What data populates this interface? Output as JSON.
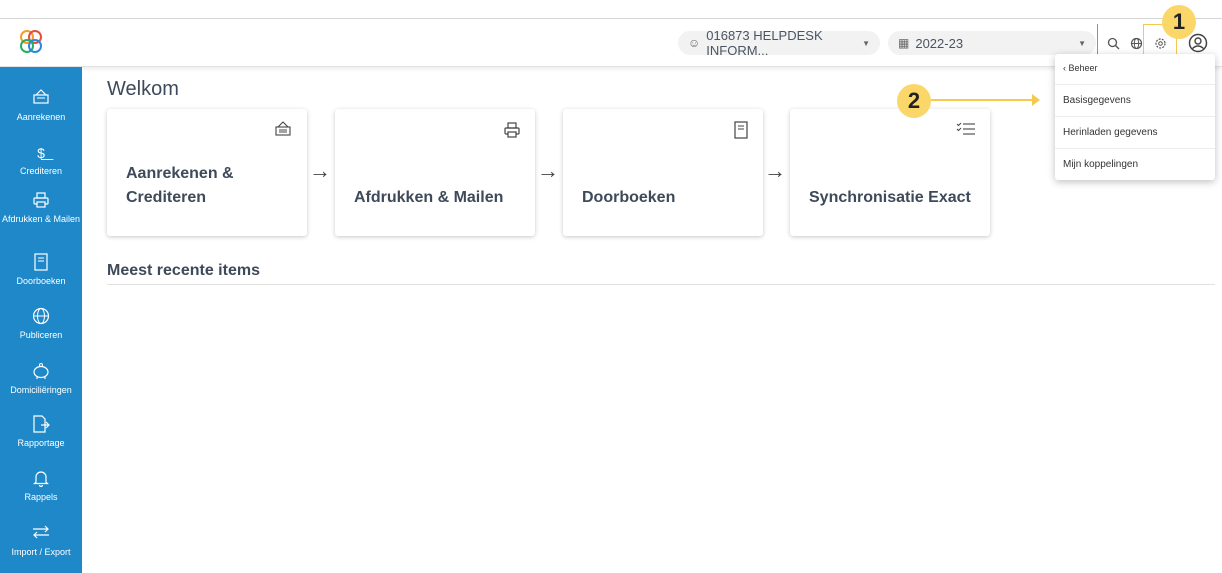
{
  "header": {
    "company_selector": {
      "value": "016873 HELPDESK INFORM...",
      "icon": "group-icon"
    },
    "year_selector": {
      "value": "2022-23",
      "icon": "calendar-icon"
    },
    "icons": [
      "search-icon",
      "globe-icon",
      "gear-icon",
      "user-icon"
    ]
  },
  "sidebar": {
    "items": [
      {
        "label": "Aanrekenen",
        "icon": "invoice-icon"
      },
      {
        "label": "Crediteren",
        "icon": "credit-icon"
      },
      {
        "label": "Afdrukken & Mailen",
        "icon": "printer-icon"
      },
      {
        "label": "Doorboeken",
        "icon": "ledger-icon"
      },
      {
        "label": "Publiceren",
        "icon": "globe-icon"
      },
      {
        "label": "Domiciliëringen",
        "icon": "piggybank-icon"
      },
      {
        "label": "Rapportage",
        "icon": "export-file-icon"
      },
      {
        "label": "Rappels",
        "icon": "bell-icon"
      },
      {
        "label": "Import / Export",
        "icon": "arrows-icon"
      }
    ]
  },
  "main": {
    "title": "Welkom",
    "cards": [
      {
        "title": "Aanrekenen & Crediteren",
        "icon": "invoice-icon"
      },
      {
        "title": "Afdrukken & Mailen",
        "icon": "printer-icon"
      },
      {
        "title": "Doorboeken",
        "icon": "ledger-icon"
      },
      {
        "title": "Synchronisatie Exact",
        "icon": "checklist-icon"
      }
    ],
    "recent_title": "Meest recente items"
  },
  "settings_menu": {
    "header": "‹ Beheer",
    "items": [
      "Basisgegevens",
      "Herinladen gegevens",
      "Mijn koppelingen"
    ]
  },
  "annotations": {
    "badge_1": "1",
    "badge_2": "2"
  },
  "colors": {
    "sidebar": "#1e88c9",
    "accent_line": "#4aa7e0",
    "annotation": "#fbd669"
  }
}
